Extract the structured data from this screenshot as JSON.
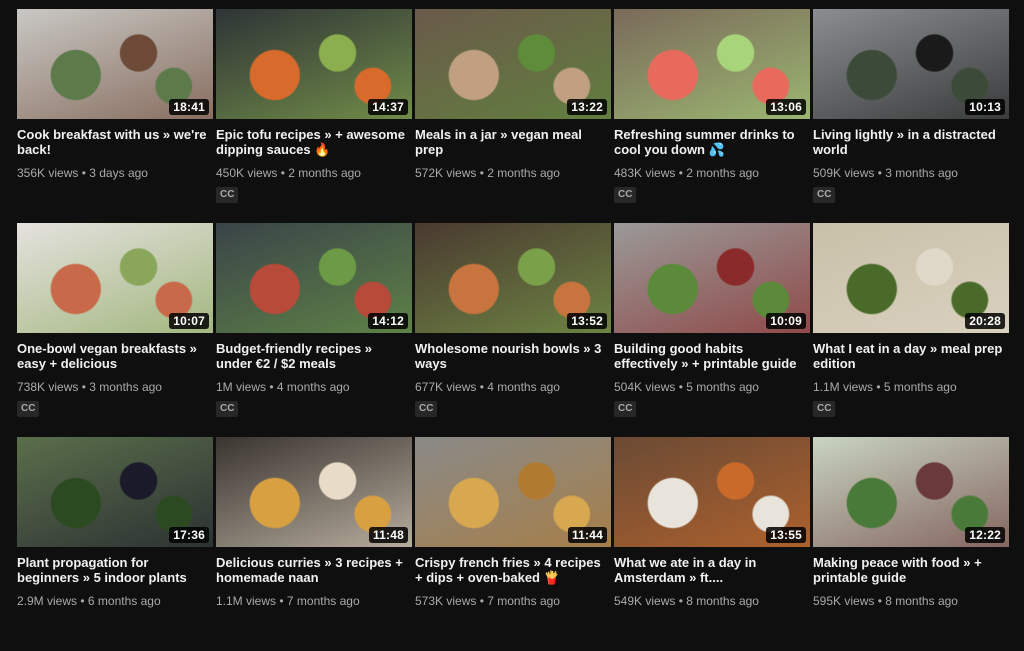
{
  "videos": [
    {
      "title": "Cook breakfast with us » we're back!",
      "views": "356K views",
      "age": "3 days ago",
      "duration": "18:41",
      "cc": "",
      "palette": [
        "#c9c8c4",
        "#5c7a4a",
        "#6e4a38"
      ]
    },
    {
      "title": "Epic tofu recipes » + awesome dipping sauces 🔥",
      "views": "450K views",
      "age": "2 months ago",
      "duration": "14:37",
      "cc": "CC",
      "palette": [
        "#2e3436",
        "#d86a2c",
        "#8bae4f"
      ]
    },
    {
      "title": "Meals in a jar » vegan meal prep",
      "views": "572K views",
      "age": "2 months ago",
      "duration": "13:22",
      "cc": "",
      "palette": [
        "#6a5a4a",
        "#c0a080",
        "#5e8c3a"
      ]
    },
    {
      "title": "Refreshing summer drinks to cool you down 💦",
      "views": "483K views",
      "age": "2 months ago",
      "duration": "13:06",
      "cc": "CC",
      "palette": [
        "#7a6a5a",
        "#e86a5c",
        "#a8d47a"
      ]
    },
    {
      "title": "Living lightly » in a distracted world",
      "views": "509K views",
      "age": "3 months ago",
      "duration": "10:13",
      "cc": "CC",
      "palette": [
        "#8a8e90",
        "#3c4a3a",
        "#1a1a1a"
      ]
    },
    {
      "title": "One-bowl vegan breakfasts » easy + delicious",
      "views": "738K views",
      "age": "3 months ago",
      "duration": "10:07",
      "cc": "CC",
      "palette": [
        "#e4e2de",
        "#c86a4a",
        "#8aa65a"
      ]
    },
    {
      "title": "Budget-friendly recipes » under €2 / $2 meals",
      "views": "1M views",
      "age": "4 months ago",
      "duration": "14:12",
      "cc": "CC",
      "palette": [
        "#3a4448",
        "#b84a3a",
        "#6c9a46"
      ]
    },
    {
      "title": "Wholesome nourish bowls » 3 ways",
      "views": "677K views",
      "age": "4 months ago",
      "duration": "13:52",
      "cc": "CC",
      "palette": [
        "#4a3a30",
        "#c8743e",
        "#7aa04a"
      ]
    },
    {
      "title": "Building good habits effectively » + printable guide",
      "views": "504K views",
      "age": "5 months ago",
      "duration": "10:09",
      "cc": "CC",
      "palette": [
        "#9a9a98",
        "#5a8a3a",
        "#8a2a2a"
      ]
    },
    {
      "title": "What I eat in a day » meal prep edition",
      "views": "1.1M views",
      "age": "5 months ago",
      "duration": "20:28",
      "cc": "CC",
      "palette": [
        "#c8c0a8",
        "#4a6a2a",
        "#e0d8c8"
      ]
    },
    {
      "title": "Plant propagation for beginners » 5 indoor plants",
      "views": "2.9M views",
      "age": "6 months ago",
      "duration": "17:36",
      "cc": "",
      "palette": [
        "#5a6e4a",
        "#2c4a22",
        "#1a1a2a"
      ]
    },
    {
      "title": "Delicious curries » 3 recipes + homemade naan",
      "views": "1.1M views",
      "age": "7 months ago",
      "duration": "11:48",
      "cc": "",
      "palette": [
        "#3a3430",
        "#d8a040",
        "#e8dcc8"
      ]
    },
    {
      "title": "Crispy french fries » 4 recipes + dips + oven-baked 🍟",
      "views": "573K views",
      "age": "7 months ago",
      "duration": "11:44",
      "cc": "",
      "palette": [
        "#8a8a88",
        "#d8a850",
        "#b07a30"
      ]
    },
    {
      "title": "What we ate in a day in Amsterdam » ft....",
      "views": "549K views",
      "age": "8 months ago",
      "duration": "13:55",
      "cc": "",
      "palette": [
        "#6a4a34",
        "#e8e4dc",
        "#c86a2a"
      ]
    },
    {
      "title": "Making peace with food » + printable guide",
      "views": "595K views",
      "age": "8 months ago",
      "duration": "12:22",
      "cc": "",
      "palette": [
        "#c8d4c0",
        "#4a7a3a",
        "#6a3a3a"
      ]
    }
  ]
}
